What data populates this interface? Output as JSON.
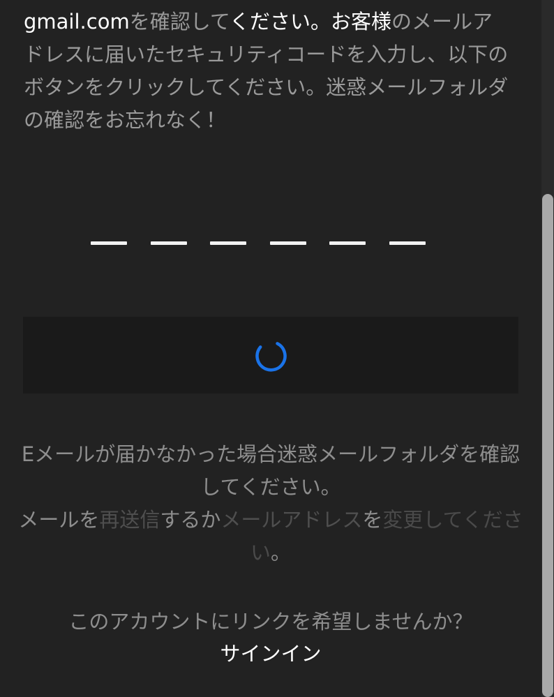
{
  "instructions": {
    "email_domain": "gmail.com",
    "segment_1": "を確認して",
    "segment_2": "ください。お客様",
    "segment_3": "のメールアドレスに届いたセキュリティコードを入力し、以下のボタンをクリックしてください。迷惑メールフォルダの確認をお忘れなく！"
  },
  "code_input": {
    "slots": [
      "",
      "",
      "",
      "",
      "",
      ""
    ]
  },
  "verify_button": {
    "state": "loading",
    "spinner_color": "#1a73e8"
  },
  "help": {
    "line_1": "Eメールが届かなかった場合迷惑メールフォルダを確認してください。",
    "prefix": "メールを",
    "resend_link": "再送信",
    "middle": "するか",
    "change_email_link": "メールアドレス",
    "particle": "を",
    "change_link": "変更してください",
    "period": "。"
  },
  "account_link": {
    "question": "このアカウントにリンクを希望しませんか？",
    "signin_label": "サインイン"
  }
}
